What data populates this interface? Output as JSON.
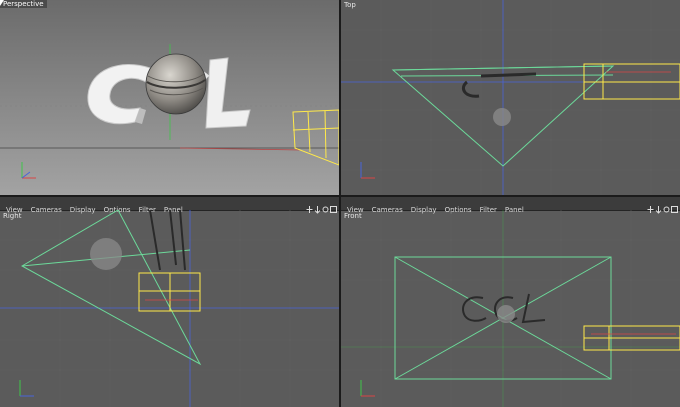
{
  "viewports": {
    "perspective": {
      "title": "Perspective"
    },
    "top": {
      "title": "Top"
    },
    "right": {
      "title": "Right"
    },
    "front": {
      "title": "Front"
    }
  },
  "menu": [
    "View",
    "Cameras",
    "Display",
    "Options",
    "Filter",
    "Panel"
  ],
  "scene": {
    "logo_text": "CCL"
  },
  "axis_labels": {
    "x": "X",
    "y": "Y",
    "z": "Z"
  },
  "colors": {
    "viewport_bg": "#5b5b5b",
    "perspective_bg_top": "#6e6e6e",
    "perspective_bg_bottom": "#9a9a9a",
    "camera_frustum": "#6cd99a",
    "selection_box": "#ffe94a",
    "axis_red": "#d84646",
    "axis_blue": "#4a64d8",
    "axis_green": "#3fc54a"
  },
  "icons": [
    "move-view-icon",
    "zoom-view-icon",
    "rotate-view-icon",
    "maximize-view-icon"
  ]
}
